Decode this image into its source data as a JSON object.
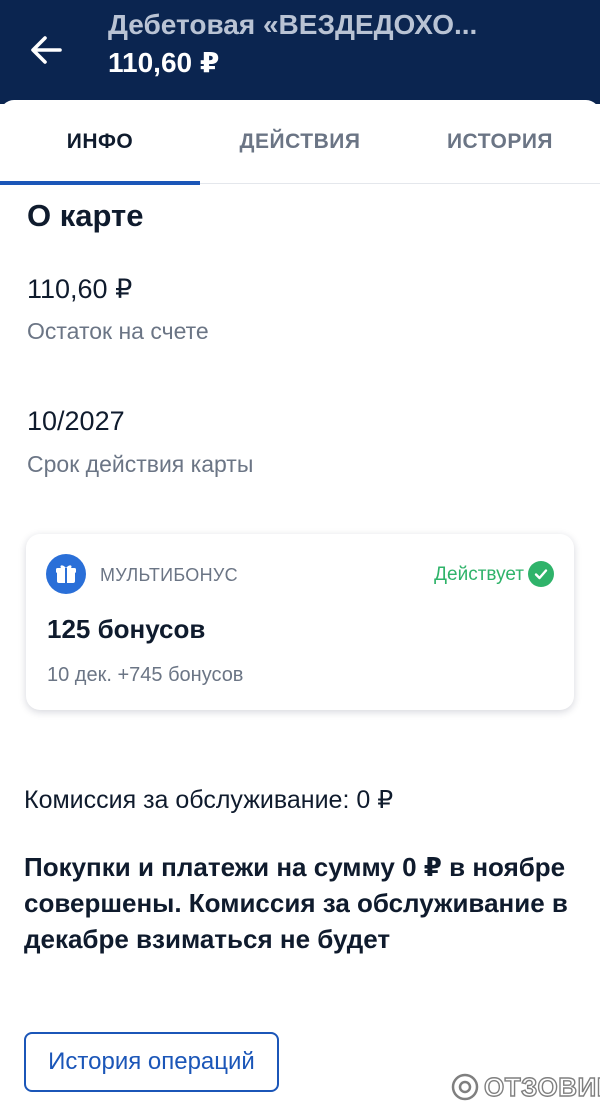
{
  "header": {
    "title": "Дебетовая «ВЕЗДЕДОХО...",
    "balance": "110,60 ₽",
    "background_color": "#0b2550"
  },
  "tabs": [
    {
      "label": "ИНФО",
      "active": true
    },
    {
      "label": "ДЕЙСТВИЯ",
      "active": false
    },
    {
      "label": "ИСТОРИЯ",
      "active": false
    }
  ],
  "about": {
    "title": "О карте",
    "balance_value": "110,60 ₽",
    "balance_label": "Остаток на счете",
    "expiry_value": "10/2027",
    "expiry_label": "Срок действия карты"
  },
  "bonus_card": {
    "icon": "gift-icon",
    "brand": "МУЛЬТИБОНУС",
    "status": "Действует",
    "status_color": "#2fb36a",
    "bonuses": "125 бонусов",
    "subtext": "10 дек. +745 бонусов"
  },
  "commission": "Комиссия за обслуживание: 0 ₽",
  "notice": "Покупки и платежи на сумму 0 ₽ в ноябре совершены. Комиссия за обслуживание в декабре взиматься не будет",
  "history_button": "История операций",
  "accent_color": "#1b56b8",
  "watermark": "ОТЗОВИК"
}
